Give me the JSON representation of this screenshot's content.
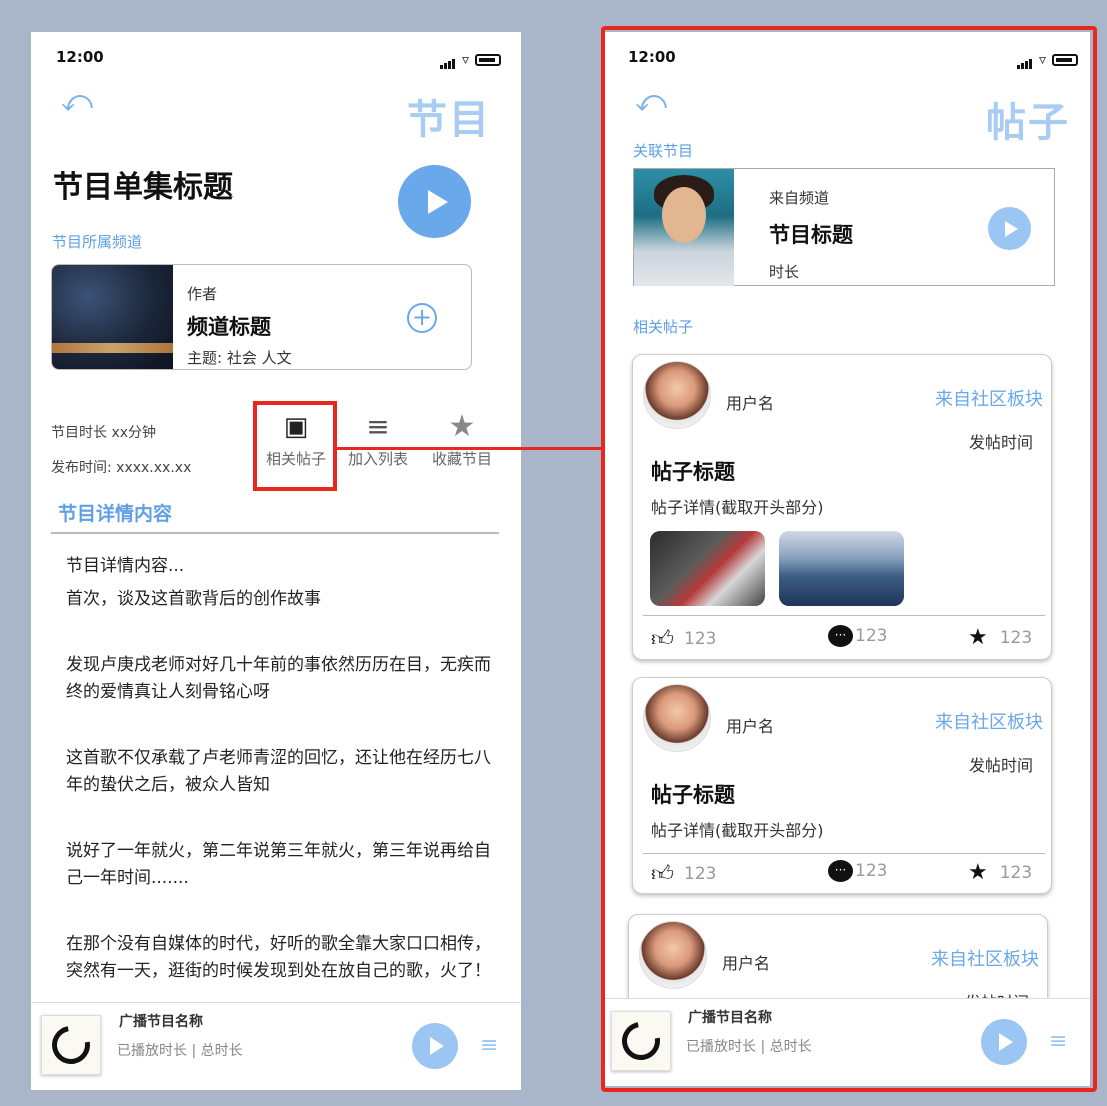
{
  "status": {
    "time": "12:00"
  },
  "left": {
    "page_title": "节目",
    "episode_title": "节目单集标题",
    "channel_section_label": "节目所属频道",
    "channel": {
      "author": "作者",
      "title": "频道标题",
      "topics": "主题: 社会 人文"
    },
    "meta": {
      "duration": "节目时长 xx分钟",
      "publish": "发布时间: xxxx.xx.xx"
    },
    "actions": [
      {
        "label": "相关帖子",
        "icon": "forum-icon"
      },
      {
        "label": "加入列表",
        "icon": "playlist-add-icon"
      },
      {
        "label": "收藏节目",
        "icon": "star-icon"
      }
    ],
    "detail_header": "节目详情内容",
    "detail_paragraphs": [
      "节目详情内容...",
      "首次，谈及这首歌背后的创作故事",
      "发现卢庚戌老师对好几十年前的事依然历历在目，无疾而终的爱情真让人刻骨铭心呀",
      "这首歌不仅承载了卢老师青涩的回忆，还让他在经历七八年的蛰伏之后，被众人皆知",
      "说好了一年就火，第二年说第三年就火，第三年说再给自己一年时间.......",
      "在那个没有自媒体的时代，好听的歌全靠大家口口相传，突然有一天，逛街的时候发现到处在放自己的歌，火了！"
    ]
  },
  "right": {
    "page_title": "帖子",
    "linked_label": "关联节目",
    "linked": {
      "from": "来自频道",
      "title": "节目标题",
      "duration": "时长"
    },
    "related_label": "相关帖子",
    "posts": [
      {
        "user": "用户名",
        "board": "来自社区板块",
        "time": "发帖时间",
        "title": "帖子标题",
        "excerpt": "帖子详情(截取开头部分)",
        "likes": "123",
        "comments": "123",
        "stars": "123"
      },
      {
        "user": "用户名",
        "board": "来自社区板块",
        "time": "发帖时间",
        "title": "帖子标题",
        "excerpt": "帖子详情(截取开头部分)",
        "likes": "123",
        "comments": "123",
        "stars": "123"
      },
      {
        "user": "用户名",
        "board": "来自社区板块",
        "time": "发帖时间"
      }
    ]
  },
  "miniplayer": {
    "title": "广播节目名称",
    "progress": "已播放时长 | 总时长"
  },
  "colors": {
    "accent": "#6aa8ec",
    "title_light": "#a9cdf2",
    "highlight_red": "#e8281f",
    "background": "#a9b6c9"
  }
}
